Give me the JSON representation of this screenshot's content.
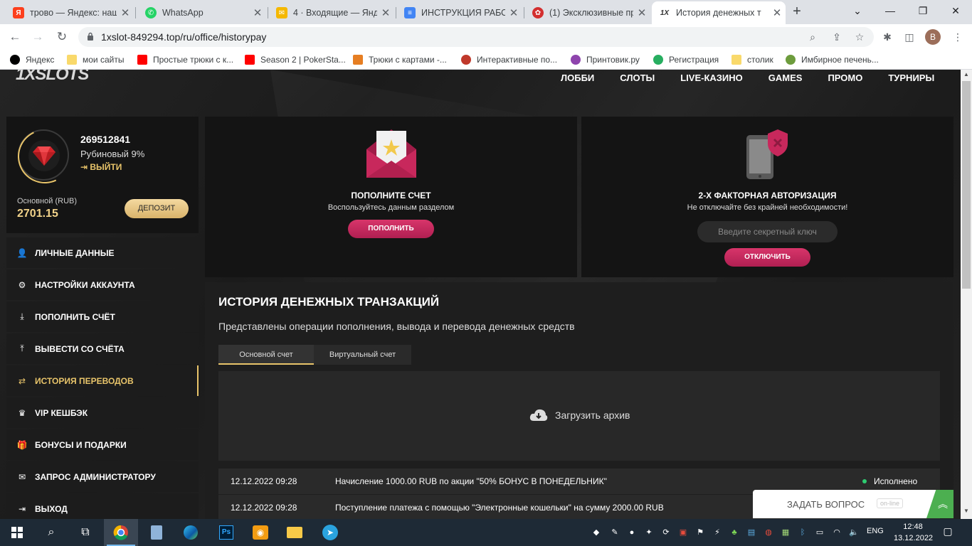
{
  "browser": {
    "tabs": [
      {
        "title": "трово — Яндекс: наш",
        "icon": "yandex-icon",
        "color": "#fc3f1d",
        "glyph": "Я"
      },
      {
        "title": "WhatsApp",
        "icon": "whatsapp-icon",
        "color": "#25d366",
        "glyph": "✆"
      },
      {
        "title": "4 · Входящие — Янде",
        "icon": "yandex-mail-icon",
        "color": "#f5b800",
        "glyph": "✉"
      },
      {
        "title": "ИНСТРУКЦИЯ РАБОТ",
        "icon": "google-docs-icon",
        "color": "#4285f4",
        "glyph": "≡"
      },
      {
        "title": "(1) Эксклюзивные пр",
        "icon": "site-icon",
        "color": "#d32f2f",
        "glyph": "✿"
      },
      {
        "title": "История денежных т",
        "icon": "1x-icon",
        "color": "#ffffff",
        "glyph": "1X"
      }
    ],
    "new_tab": "+",
    "window_controls": {
      "menu": "⌄",
      "minimize": "—",
      "maximize": "❐",
      "close": "✕"
    },
    "nav": {
      "back": "←",
      "forward": "→",
      "reload": "↻"
    },
    "url": "1xslot-849294.top/ru/office/historypay",
    "omnibox_icons": {
      "zoom": "⌕",
      "share": "⇪",
      "star": "☆"
    },
    "toolbar_icons": {
      "extensions": "✱",
      "sidepanel": "◫",
      "menu": "⋮"
    },
    "profile_initial": "В"
  },
  "bookmarks": [
    {
      "label": "Яндекс",
      "color": "#000000"
    },
    {
      "label": "мои сайты",
      "color": "#f9d96b"
    },
    {
      "label": "Простые трюки с к...",
      "color": "#ff0000"
    },
    {
      "label": "Season 2 | PokerSta...",
      "color": "#ff0000"
    },
    {
      "label": "Трюки с картами -...",
      "color": "#e67e22"
    },
    {
      "label": "Интерактивные по...",
      "color": "#c0392b"
    },
    {
      "label": "Принтовик.ру",
      "color": "#8e44ad"
    },
    {
      "label": "Регистрация",
      "color": "#27ae60"
    },
    {
      "label": "столик",
      "color": "#f9d96b"
    },
    {
      "label": "Имбирное печень...",
      "color": "#6d9c3d"
    }
  ],
  "site": {
    "logo": {
      "accent": "1X",
      "text": "SLOTS"
    },
    "nav": [
      "ЛОББИ",
      "СЛОТЫ",
      "LIVE-КАЗИНО",
      "GAMES",
      "ПРОМО",
      "ТУРНИРЫ"
    ]
  },
  "profile": {
    "user_id": "269512841",
    "level": "Рубиновый 9%",
    "logout": "ВЫЙТИ",
    "account_label": "Основной (RUB)",
    "balance": "2701.15",
    "deposit_button": "ДЕПОЗИТ"
  },
  "menu": [
    {
      "label": "ЛИЧНЫЕ ДАННЫЕ",
      "icon": "user-plus-icon",
      "glyph": "👤"
    },
    {
      "label": "НАСТРОЙКИ АККАУНТА",
      "icon": "gears-icon",
      "glyph": "⚙"
    },
    {
      "label": "ПОПОЛНИТЬ СЧЁТ",
      "icon": "download-icon",
      "glyph": "⤓"
    },
    {
      "label": "ВЫВЕСТИ СО СЧЁТА",
      "icon": "upload-icon",
      "glyph": "⤒"
    },
    {
      "label": "ИСТОРИЯ ПЕРЕВОДОВ",
      "icon": "transfer-arrows-icon",
      "glyph": "⇄"
    },
    {
      "label": "VIP КЕШБЭК",
      "icon": "crown-icon",
      "glyph": "♛"
    },
    {
      "label": "БОНУСЫ И ПОДАРКИ",
      "icon": "gift-icon",
      "glyph": "🎁"
    },
    {
      "label": "ЗАПРОС АДМИНИСТРАТОРУ",
      "icon": "envelope-icon",
      "glyph": "✉"
    },
    {
      "label": "ВЫХОД",
      "icon": "logout-icon",
      "glyph": "⇥"
    }
  ],
  "active_menu": "ИСТОРИЯ ПЕРЕВОДОВ",
  "deposit_card": {
    "title": "ПОПОЛНИТЕ СЧЕТ",
    "subtitle": "Воспользуйтесь данным разделом",
    "button": "ПОПОЛНИТЬ"
  },
  "twofa_card": {
    "title": "2-Х ФАКТОРНАЯ АВТОРИЗАЦИЯ",
    "subtitle": "Не отключайте без крайней необходимости!",
    "placeholder": "Введите секретный ключ",
    "button": "ОТКЛЮЧИТЬ"
  },
  "history": {
    "title": "ИСТОРИЯ ДЕНЕЖНЫХ ТРАНЗАКЦИЙ",
    "description": "Представлены операции пополнения, вывода и перевода денежных средств",
    "tabs": [
      "Основной счет",
      "Виртуальный счет"
    ],
    "archive_button": "Загрузить архив",
    "rows": [
      {
        "date": "12.12.2022 09:28",
        "text": "Начисление 1000.00 RUB по акции \"50% БОНУС В ПОНЕДЕЛЬНИК\"",
        "status": "Исполнено"
      },
      {
        "date": "12.12.2022 09:28",
        "text": "Поступление платежа с помощью \"Электронные кошельки\" на сумму 2000.00 RUB",
        "status": ""
      }
    ]
  },
  "chat": {
    "label": "ЗАДАТЬ ВОПРОС",
    "status": "on-line"
  },
  "colors": {
    "gold": "#e8c46a",
    "pink": "#c8285c",
    "success": "#2ecc71"
  },
  "taskbar": {
    "language": "ENG",
    "time": "12:48",
    "date": "13.12.2022"
  }
}
